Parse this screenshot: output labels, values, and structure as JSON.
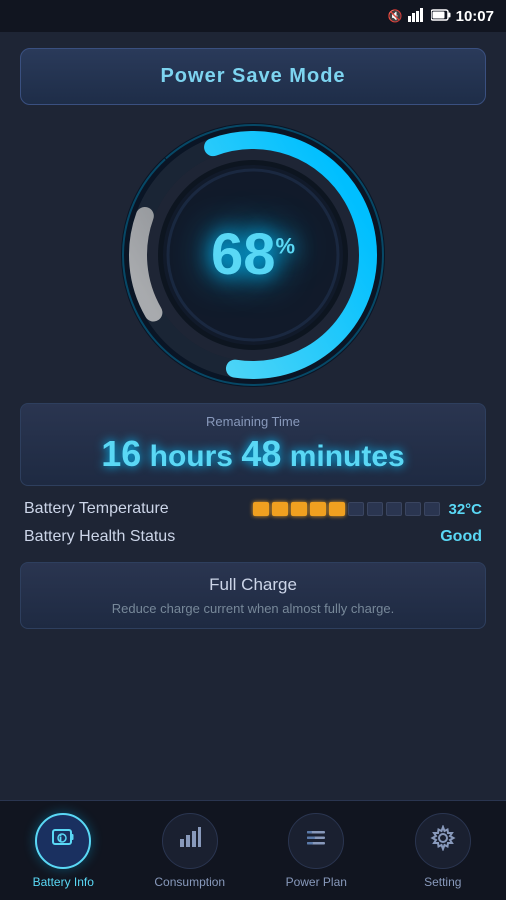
{
  "statusBar": {
    "time": "10:07",
    "icons": [
      "mute",
      "signal",
      "battery"
    ]
  },
  "powerSave": {
    "label": "Power Save Mode"
  },
  "gauge": {
    "percentage": "68",
    "percentSymbol": "%",
    "filled": 68
  },
  "remainingTime": {
    "label": "Remaining Time",
    "hours": "16",
    "hoursLabel": "hours",
    "minutes": "48",
    "minutesLabel": "minutes"
  },
  "batteryTemp": {
    "label": "Battery Temperature",
    "value": "32°C",
    "activeSegments": 5,
    "totalSegments": 10
  },
  "batteryHealth": {
    "label": "Battery Health Status",
    "value": "Good"
  },
  "fullCharge": {
    "title": "Full Charge",
    "description": "Reduce charge current when almost fully charge."
  },
  "nav": {
    "items": [
      {
        "id": "battery-info",
        "label": "Battery Info",
        "icon": "🔋",
        "active": true
      },
      {
        "id": "consumption",
        "label": "Consumption",
        "icon": "📊",
        "active": false
      },
      {
        "id": "power-plan",
        "label": "Power Plan",
        "icon": "☰",
        "active": false
      },
      {
        "id": "setting",
        "label": "Setting",
        "icon": "⚙",
        "active": false
      }
    ]
  }
}
